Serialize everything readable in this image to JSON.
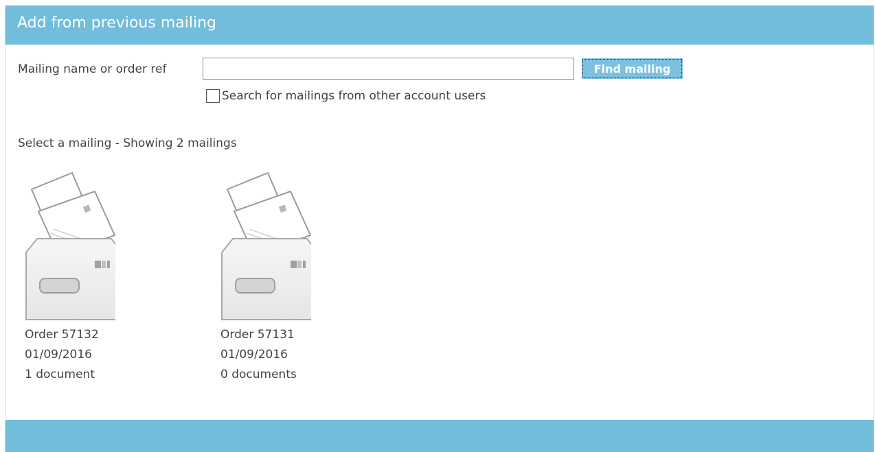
{
  "dialog": {
    "title": "Add from previous mailing"
  },
  "search": {
    "label": "Mailing name or order ref",
    "value": "",
    "placeholder": "",
    "button_label": "Find mailing",
    "other_users_checkbox_label": "Search for mailings from other account users",
    "other_users_checked": false
  },
  "results": {
    "caption": "Select a mailing - Showing 2 mailings",
    "mailings": [
      {
        "icon": "envelope-with-letters-icon",
        "order": "Order 57132",
        "date": "01/09/2016",
        "documents": "1 document"
      },
      {
        "icon": "envelope-with-letters-icon",
        "order": "Order 57131",
        "date": "01/09/2016",
        "documents": "0 documents"
      }
    ]
  },
  "colors": {
    "header_bar": "#72bcdc",
    "button": "#7dc0e0",
    "text": "#444444"
  }
}
